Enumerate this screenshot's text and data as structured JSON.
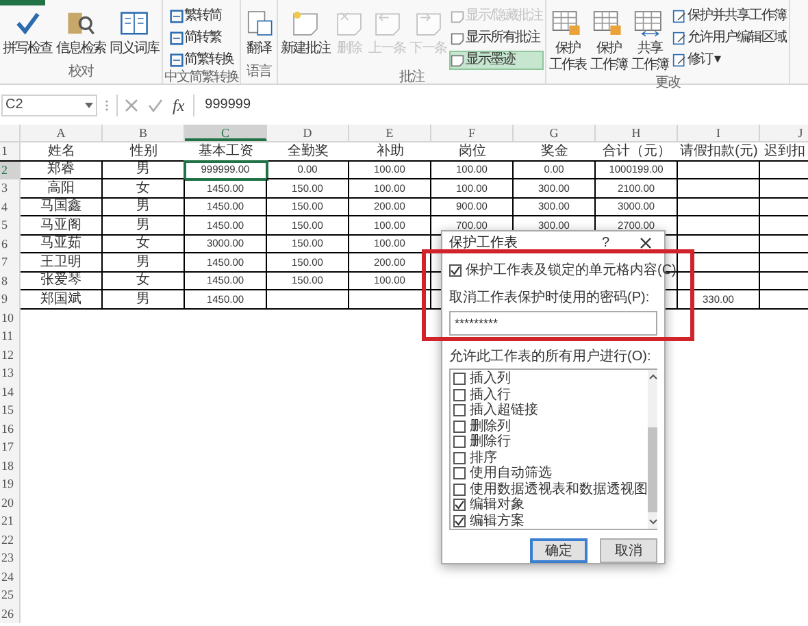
{
  "ribbon": {
    "groups": [
      {
        "label": "校对",
        "buttons": [
          {
            "kind": "large",
            "lines": [
              "拼写检查"
            ],
            "disabled": false,
            "active": false
          },
          {
            "kind": "large",
            "lines": [
              "信息检索"
            ],
            "disabled": false,
            "active": false
          },
          {
            "kind": "large",
            "lines": [
              "同义词库"
            ],
            "disabled": false,
            "active": false
          }
        ]
      },
      {
        "label": "中文简繁转换",
        "buttons": [
          {
            "kind": "small",
            "lines": [
              "繁转简"
            ],
            "disabled": false,
            "active": false
          },
          {
            "kind": "small",
            "lines": [
              "简转繁"
            ],
            "disabled": false,
            "active": false
          },
          {
            "kind": "small",
            "lines": [
              "简繁转换"
            ],
            "disabled": false,
            "active": false
          }
        ]
      },
      {
        "label": "语言",
        "buttons": [
          {
            "kind": "large",
            "lines": [
              "翻译"
            ],
            "disabled": false,
            "active": false
          }
        ]
      },
      {
        "label": "批注",
        "buttons": [
          {
            "kind": "large",
            "lines": [
              "新建批注"
            ],
            "disabled": false,
            "active": false
          },
          {
            "kind": "large",
            "lines": [
              "删除"
            ],
            "disabled": true,
            "active": false
          },
          {
            "kind": "large",
            "lines": [
              "上一条"
            ],
            "disabled": true,
            "active": false
          },
          {
            "kind": "large",
            "lines": [
              "下一条"
            ],
            "disabled": true,
            "active": false
          },
          {
            "kind": "small",
            "lines": [
              "显示/隐藏批注"
            ],
            "disabled": true,
            "active": false
          },
          {
            "kind": "small",
            "lines": [
              "显示所有批注"
            ],
            "disabled": false,
            "active": false
          },
          {
            "kind": "small",
            "lines": [
              "显示墨迹"
            ],
            "disabled": false,
            "active": true
          }
        ]
      },
      {
        "label": "更改",
        "buttons": [
          {
            "kind": "large",
            "lines": [
              "保护",
              "工作表"
            ],
            "disabled": false,
            "active": false
          },
          {
            "kind": "large",
            "lines": [
              "保护",
              "工作簿"
            ],
            "disabled": false,
            "active": false
          },
          {
            "kind": "large",
            "lines": [
              "共享",
              "工作簿"
            ],
            "disabled": false,
            "active": false
          },
          {
            "kind": "small",
            "lines": [
              "保护并共享工作簿"
            ],
            "disabled": false,
            "active": false
          },
          {
            "kind": "small",
            "lines": [
              "允许用户编辑区域"
            ],
            "disabled": false,
            "active": false
          },
          {
            "kind": "small",
            "lines": [
              "修订 ▾"
            ],
            "disabled": false,
            "active": false
          }
        ]
      }
    ]
  },
  "formula_bar": {
    "name_box": "C2",
    "function_label": "fx",
    "value": "999999"
  },
  "sheet": {
    "columns": [
      {
        "label": "A",
        "selected": false
      },
      {
        "label": "B",
        "selected": false
      },
      {
        "label": "C",
        "selected": true
      },
      {
        "label": "D",
        "selected": false
      },
      {
        "label": "E",
        "selected": false
      },
      {
        "label": "F",
        "selected": false
      },
      {
        "label": "G",
        "selected": false
      },
      {
        "label": "H",
        "selected": false
      },
      {
        "label": "I",
        "selected": false
      },
      {
        "label": "J",
        "selected": false
      }
    ],
    "rows": [
      {
        "label": "1",
        "selected": false,
        "cells": {
          "A": "姓名",
          "B": "性别",
          "C": "基本工资",
          "D": "全勤奖",
          "E": "补助",
          "F": "岗位",
          "G": "奖金",
          "H": "合计（元）",
          "I": "请假扣款(元)",
          "J": "迟到扣"
        }
      },
      {
        "label": "2",
        "selected": true,
        "cells": {
          "A": "郑睿",
          "B": "男",
          "C": "999999.00",
          "D": "0.00",
          "E": "100.00",
          "F": "100.00",
          "G": "0.00",
          "H": "1000199.00"
        }
      },
      {
        "label": "3",
        "selected": false,
        "cells": {
          "A": "高阳",
          "B": "女",
          "C": "1450.00",
          "D": "150.00",
          "E": "100.00",
          "F": "100.00",
          "G": "300.00",
          "H": "2100.00"
        }
      },
      {
        "label": "4",
        "selected": false,
        "cells": {
          "A": "马国鑫",
          "B": "男",
          "C": "1450.00",
          "D": "150.00",
          "E": "200.00",
          "F": "900.00",
          "G": "300.00",
          "H": "3000.00"
        }
      },
      {
        "label": "5",
        "selected": false,
        "cells": {
          "A": "马亚阁",
          "B": "男",
          "C": "1450.00",
          "D": "150.00",
          "E": "100.00",
          "F": "700.00",
          "G": "300.00",
          "H": "2700.00"
        }
      },
      {
        "label": "6",
        "selected": false,
        "cells": {
          "A": "马亚茹",
          "B": "女",
          "C": "3000.00",
          "D": "150.00",
          "E": "100.00"
        }
      },
      {
        "label": "7",
        "selected": false,
        "cells": {
          "A": "王卫明",
          "B": "男",
          "C": "1450.00",
          "D": "150.00",
          "E": "200.00"
        }
      },
      {
        "label": "8",
        "selected": false,
        "cells": {
          "A": "张爱琴",
          "B": "女",
          "C": "1450.00",
          "D": "150.00",
          "E": "100.00"
        }
      },
      {
        "label": "9",
        "selected": false,
        "cells": {
          "A": "郑国斌",
          "B": "男",
          "C": "1450.00",
          "I": "330.00"
        }
      },
      {
        "label": "10",
        "selected": false,
        "cells": {}
      },
      {
        "label": "11",
        "selected": false,
        "cells": {}
      },
      {
        "label": "12",
        "selected": false,
        "cells": {}
      },
      {
        "label": "13",
        "selected": false,
        "cells": {}
      },
      {
        "label": "14",
        "selected": false,
        "cells": {}
      },
      {
        "label": "15",
        "selected": false,
        "cells": {}
      },
      {
        "label": "16",
        "selected": false,
        "cells": {}
      },
      {
        "label": "17",
        "selected": false,
        "cells": {}
      },
      {
        "label": "18",
        "selected": false,
        "cells": {}
      },
      {
        "label": "19",
        "selected": false,
        "cells": {}
      },
      {
        "label": "20",
        "selected": false,
        "cells": {}
      },
      {
        "label": "21",
        "selected": false,
        "cells": {}
      },
      {
        "label": "22",
        "selected": false,
        "cells": {}
      },
      {
        "label": "23",
        "selected": false,
        "cells": {}
      },
      {
        "label": "24",
        "selected": false,
        "cells": {}
      },
      {
        "label": "25",
        "selected": false,
        "cells": {}
      },
      {
        "label": "26",
        "selected": false,
        "cells": {}
      }
    ]
  },
  "dialog": {
    "title": "保护工作表",
    "help": "?",
    "protect_option": {
      "label": "保护工作表及锁定的单元格内容(C)",
      "checked": true
    },
    "password_label": "取消工作表保护时使用的密码(P):",
    "password_value": "*********",
    "permissions_label": "允许此工作表的所有用户进行(O):",
    "permissions": [
      {
        "label": "插入列",
        "checked": false
      },
      {
        "label": "插入行",
        "checked": false
      },
      {
        "label": "插入超链接",
        "checked": false
      },
      {
        "label": "删除列",
        "checked": false
      },
      {
        "label": "删除行",
        "checked": false
      },
      {
        "label": "排序",
        "checked": false
      },
      {
        "label": "使用自动筛选",
        "checked": false
      },
      {
        "label": "使用数据透视表和数据透视图",
        "checked": false
      },
      {
        "label": "编辑对象",
        "checked": true
      },
      {
        "label": "编辑方案",
        "checked": true
      }
    ],
    "buttons": [
      {
        "label": "确定",
        "default": true
      },
      {
        "label": "取消",
        "default": false
      }
    ]
  }
}
